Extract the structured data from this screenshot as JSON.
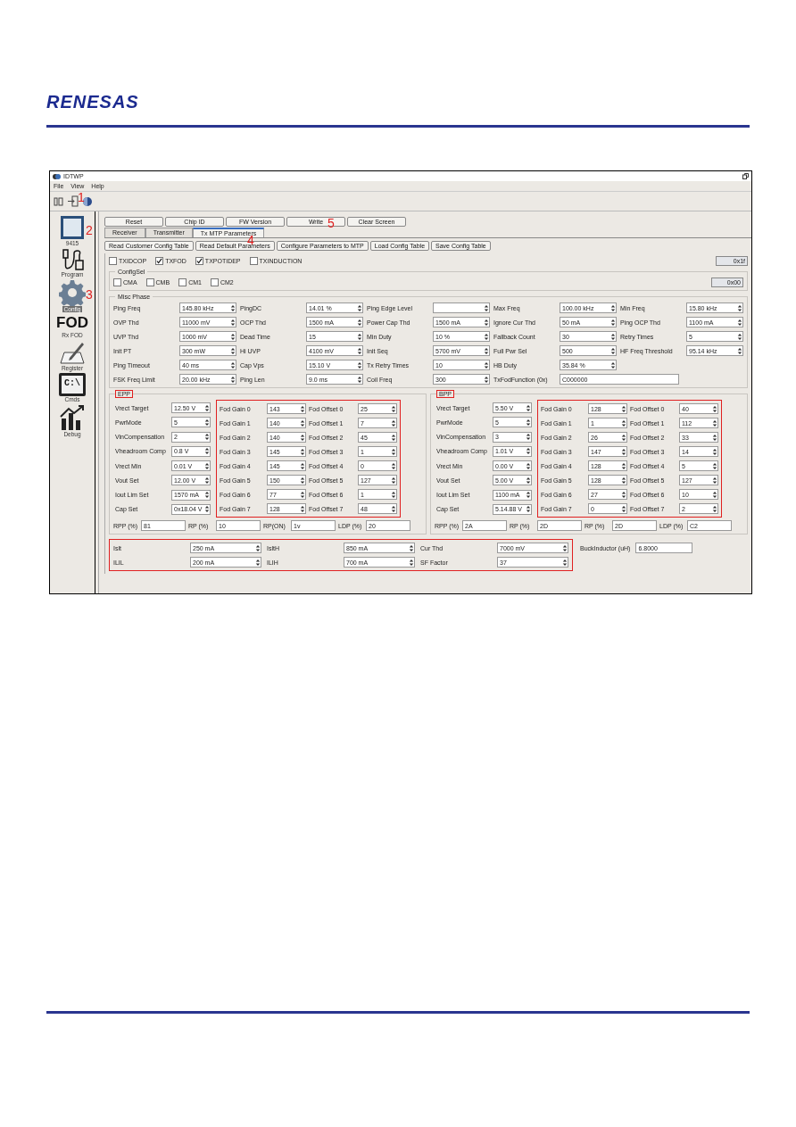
{
  "document": {
    "logo": "RENESAS"
  },
  "window": {
    "title": "IDTWP"
  },
  "menu": [
    "File",
    "View",
    "Help"
  ],
  "toolbar": {
    "callout": "1"
  },
  "sidebar": {
    "items": [
      {
        "kind": "chip",
        "label": "9415",
        "selected": false,
        "callout": "2"
      },
      {
        "kind": "program",
        "label": "Program",
        "selected": false
      },
      {
        "kind": "config",
        "label": "Config",
        "selected": true,
        "callout": "3"
      },
      {
        "kind": "glyph",
        "glyph": "FOD",
        "label": "Rx FOD",
        "selected": false
      },
      {
        "kind": "register",
        "label": "Register",
        "selected": false
      },
      {
        "kind": "cmds",
        "glyph": "C:\\",
        "label": "Cmds",
        "selected": false
      },
      {
        "kind": "debug",
        "label": "Debug",
        "selected": false
      }
    ]
  },
  "actions": [
    "Reset",
    "Chip ID",
    "FW Version",
    "Write",
    "Clear Screen"
  ],
  "tabs": {
    "callout": "5",
    "items": [
      {
        "label": "Receiver",
        "selected": false
      },
      {
        "label": "Transmitter",
        "selected": false
      },
      {
        "label": "Tx MTP Parameters",
        "selected": true
      }
    ]
  },
  "config_buttons": {
    "callout": "4",
    "items": [
      "Read Customer Config Table",
      "Read Default Parameters",
      "Configure Parameters to MTP",
      "Load Config Table",
      "Save Config Table"
    ]
  },
  "flags": {
    "checkboxes": [
      {
        "label": "TXIDCOP",
        "checked": false
      },
      {
        "label": "TXFOD",
        "checked": true
      },
      {
        "label": "TXPOTIDEP",
        "checked": true
      },
      {
        "label": "TXINDUCTION",
        "checked": false
      }
    ],
    "value": "0x1f"
  },
  "commands": {
    "title": "ConfigSel",
    "checkboxes": [
      {
        "label": "CMA",
        "checked": false
      },
      {
        "label": "CMB",
        "checked": false
      },
      {
        "label": "CM1",
        "checked": false
      },
      {
        "label": "CM2",
        "checked": false
      }
    ],
    "value": "0x00"
  },
  "misc": {
    "title": "Misc Phase",
    "rows": [
      [
        {
          "label": "Ping Freq",
          "value": "145.80 kHz",
          "kind": "spin"
        },
        {
          "label": "PingDC",
          "value": "14.01 %",
          "kind": "spin"
        },
        {
          "label": "Ping Edge Level",
          "kind": "spin"
        },
        {
          "label": "Max Freq",
          "value": "100.00 kHz",
          "kind": "spin"
        },
        {
          "label": "Min Freq",
          "value": "15.80 kHz",
          "kind": "spin"
        }
      ],
      [
        {
          "label": "OVP Thd",
          "value": "11000 mV",
          "kind": "spin"
        },
        {
          "label": "OCP Thd",
          "value": "1500 mA",
          "kind": "spin"
        },
        {
          "label": "Power Cap Thd",
          "value": "1500 mA",
          "kind": "spin"
        },
        {
          "label": "Ignore Cur Thd",
          "value": "50 mA",
          "kind": "spin"
        },
        {
          "label": "Ping OCP Thd",
          "value": "1100 mA",
          "kind": "spin"
        }
      ],
      [
        {
          "label": "UVP Thd",
          "value": "1000 mV",
          "kind": "spin"
        },
        {
          "label": "Dead Time",
          "value": "15",
          "kind": "spin"
        },
        {
          "label": "Min Duty",
          "value": "10 %",
          "kind": "spin"
        },
        {
          "label": "Fallback Count",
          "value": "30",
          "kind": "spin"
        },
        {
          "label": "Retry Times",
          "value": "5",
          "kind": "spin"
        }
      ],
      [
        {
          "label": "Init PT",
          "value": "300 mW",
          "kind": "spin"
        },
        {
          "label": "Hi UVP",
          "value": "4100 mV",
          "kind": "spin"
        },
        {
          "label": "Init Seq",
          "value": "5700 mV",
          "kind": "spin"
        },
        {
          "label": "Full Pwr Sel",
          "value": "500",
          "kind": "spin"
        },
        {
          "label": "HF Freq Threshold",
          "value": "95.14 kHz",
          "kind": "spin"
        }
      ],
      [
        {
          "label": "Ping Timeout",
          "value": "40 ms",
          "kind": "spin"
        },
        {
          "label": "Cap Vps",
          "value": "15.10 V",
          "kind": "spin"
        },
        {
          "label": "Tx Retry Times",
          "value": "10",
          "kind": "spin"
        },
        {
          "label": "HB Duty",
          "value": "35.84 %",
          "kind": "spin"
        }
      ],
      [
        {
          "label": "FSK Freq Limit",
          "value": "20.00 kHz",
          "kind": "spin"
        },
        {
          "label": "Ping Len",
          "value": "9.0 ms",
          "kind": "spin"
        },
        {
          "label": "Coil Freq",
          "value": "300",
          "kind": "spin"
        },
        {
          "label": "TxFodFunction (0x)",
          "value": "C000000",
          "kind": "text"
        }
      ]
    ]
  },
  "power_groups": [
    {
      "title": "EPP",
      "title_highlighted": true,
      "fod_highlighted": true,
      "params": [
        {
          "label": "Vrect Target",
          "value": "12.50 V"
        },
        {
          "label": "PwrMode",
          "value": "5"
        },
        {
          "label": "VinCompensation",
          "value": "2"
        },
        {
          "label": "Vheadroom Comp",
          "value": "0.8 V"
        },
        {
          "label": "Vrect Min",
          "value": "0.01 V"
        },
        {
          "label": "Vout Set",
          "value": "12.00 V"
        },
        {
          "label": "Iout Lim Set",
          "value": "1570 mA"
        },
        {
          "label": "Cap Set",
          "value": "0x18.04 V"
        }
      ],
      "gains": [
        {
          "label": "Fod Gain 0",
          "value": "143"
        },
        {
          "label": "Fod Gain 1",
          "value": "140"
        },
        {
          "label": "Fod Gain 2",
          "value": "140"
        },
        {
          "label": "Fod Gain 3",
          "value": "145"
        },
        {
          "label": "Fod Gain 4",
          "value": "145"
        },
        {
          "label": "Fod Gain 5",
          "value": "150"
        },
        {
          "label": "Fod Gain 6",
          "value": "77"
        },
        {
          "label": "Fod Gain 7",
          "value": "128"
        }
      ],
      "offsets": [
        {
          "label": "Fod Offset 0",
          "value": "25"
        },
        {
          "label": "Fod Offset 1",
          "value": "7"
        },
        {
          "label": "Fod Offset 2",
          "value": "45"
        },
        {
          "label": "Fod Offset 3",
          "value": "1"
        },
        {
          "label": "Fod Offset 4",
          "value": "0"
        },
        {
          "label": "Fod Offset 5",
          "value": "127"
        },
        {
          "label": "Fod Offset 6",
          "value": "1"
        },
        {
          "label": "Fod Offset 7",
          "value": "48"
        }
      ],
      "footer": [
        {
          "label": "RPP (%)",
          "value": "81"
        },
        {
          "label": "RP (%)",
          "value": "10"
        },
        {
          "label": "RP(ON)",
          "value": "1v"
        },
        {
          "label": "LDP (%)",
          "value": "20"
        }
      ]
    },
    {
      "title": "BPP",
      "title_highlighted": true,
      "fod_highlighted": true,
      "params": [
        {
          "label": "Vrect Target",
          "value": "5.50 V"
        },
        {
          "label": "PwrMode",
          "value": "5"
        },
        {
          "label": "VinCompensation",
          "value": "3"
        },
        {
          "label": "Vheadroom Comp",
          "value": "1.01 V"
        },
        {
          "label": "Vrect Min",
          "value": "0.00 V"
        },
        {
          "label": "Vout Set",
          "value": "5.00 V"
        },
        {
          "label": "Iout Lim Set",
          "value": "1100 mA"
        },
        {
          "label": "Cap Set",
          "value": "5.14.88 V"
        }
      ],
      "gains": [
        {
          "label": "Fod Gain 0",
          "value": "128"
        },
        {
          "label": "Fod Gain 1",
          "value": "1"
        },
        {
          "label": "Fod Gain 2",
          "value": "26"
        },
        {
          "label": "Fod Gain 3",
          "value": "147"
        },
        {
          "label": "Fod Gain 4",
          "value": "128"
        },
        {
          "label": "Fod Gain 5",
          "value": "128"
        },
        {
          "label": "Fod Gain 6",
          "value": "27"
        },
        {
          "label": "Fod Gain 7",
          "value": "0"
        }
      ],
      "offsets": [
        {
          "label": "Fod Offset 0",
          "value": "40"
        },
        {
          "label": "Fod Offset 1",
          "value": "112"
        },
        {
          "label": "Fod Offset 2",
          "value": "33"
        },
        {
          "label": "Fod Offset 3",
          "value": "14"
        },
        {
          "label": "Fod Offset 4",
          "value": "5"
        },
        {
          "label": "Fod Offset 5",
          "value": "127"
        },
        {
          "label": "Fod Offset 6",
          "value": "10"
        },
        {
          "label": "Fod Offset 7",
          "value": "2"
        }
      ],
      "footer": [
        {
          "label": "RPP (%)",
          "value": "2A"
        },
        {
          "label": "RP (%)",
          "value": "2D"
        },
        {
          "label": "RP (%)",
          "value": "2D"
        },
        {
          "label": "LDP (%)",
          "value": "C2"
        }
      ]
    }
  ],
  "limits": {
    "highlighted": true,
    "fields": [
      {
        "label": "Islt",
        "value": "250 mA"
      },
      {
        "label": "IsltH",
        "value": "850 mA"
      },
      {
        "label": "Cur Thd",
        "value": "7000 mV"
      },
      {
        "label": "ILIL",
        "value": "200 mA"
      },
      {
        "label": "ILIH",
        "value": "700 mA"
      },
      {
        "label": "SF Factor",
        "value": "37"
      }
    ],
    "extra": {
      "label": "BuckInductor (uH)",
      "value": "6.8000"
    }
  }
}
